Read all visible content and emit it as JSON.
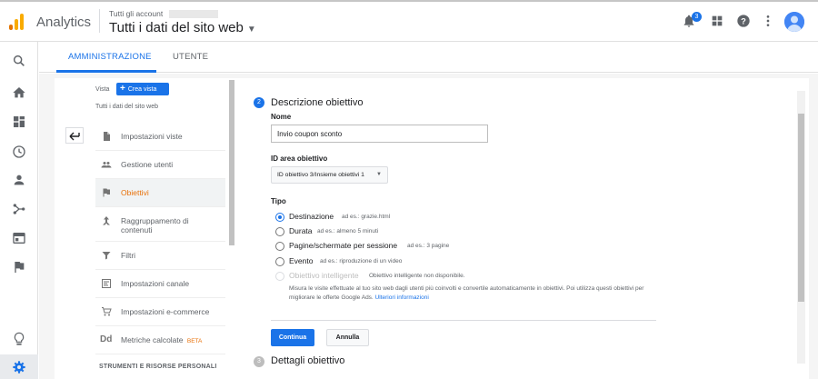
{
  "app": {
    "name": "Analytics"
  },
  "account": {
    "line": "Tutti gli account",
    "property": "Tutti i dati del sito web"
  },
  "header": {
    "notifications_count": "3"
  },
  "tabs": [
    {
      "label": "AMMINISTRAZIONE",
      "active": true
    },
    {
      "label": "UTENTE",
      "active": false
    }
  ],
  "view_panel": {
    "view_label": "Vista",
    "create_view_label": "Crea vista",
    "current_view": "Tutti i dati del sito web",
    "menu": [
      {
        "label": "Impostazioni viste",
        "icon": "document-icon"
      },
      {
        "label": "Gestione utenti",
        "icon": "people-icon"
      },
      {
        "label": "Obiettivi",
        "icon": "flag-icon",
        "active": true
      },
      {
        "label": "Raggruppamento di contenuti",
        "icon": "grouping-icon"
      },
      {
        "label": "Filtri",
        "icon": "filter-icon"
      },
      {
        "label": "Impostazioni canale",
        "icon": "channel-icon"
      },
      {
        "label": "Impostazioni e-commerce",
        "icon": "cart-icon"
      },
      {
        "label": "Metriche calcolate",
        "icon": "dd-icon",
        "badge": "BETA"
      }
    ],
    "section_header": "STRUMENTI E RISORSE PERSONALI"
  },
  "goal_form": {
    "step2": {
      "number": "2",
      "title": "Descrizione obiettivo"
    },
    "name_label": "Nome",
    "name_value": "Invio coupon sconto",
    "id_label": "ID area obiettivo",
    "id_value": "ID obiettivo 3/Insieme obiettivi 1",
    "type_label": "Tipo",
    "types": [
      {
        "label": "Destinazione",
        "hint": "ad es.: grazie.html",
        "checked": true
      },
      {
        "label": "Durata",
        "hint": "ad es.: almeno 5 minuti"
      },
      {
        "label": "Pagine/schermate per sessione",
        "hint": "ad es.: 3 pagine"
      },
      {
        "label": "Evento",
        "hint": "ad es.: riproduzione di un video"
      },
      {
        "label": "Obiettivo intelligente",
        "hint": "Obiettivo intelligente non disponibile.",
        "disabled": true
      }
    ],
    "smart_desc_1": "Misura le visite effettuate al tuo sito web dagli utenti più coinvolti e convertile automaticamente in obiettivi. Poi utilizza questi obiettivi per migliorare le offerte Google Ads.",
    "smart_desc_link": "Ulteriori informazioni",
    "continue_label": "Continua",
    "cancel_label": "Annulla",
    "step3": {
      "number": "3",
      "title": "Dettagli obiettivo"
    }
  },
  "colors": {
    "accent": "#1a73e8",
    "active_menu": "#e8710a",
    "logo_orange": "#f9ab00",
    "logo_dark": "#e37400"
  }
}
